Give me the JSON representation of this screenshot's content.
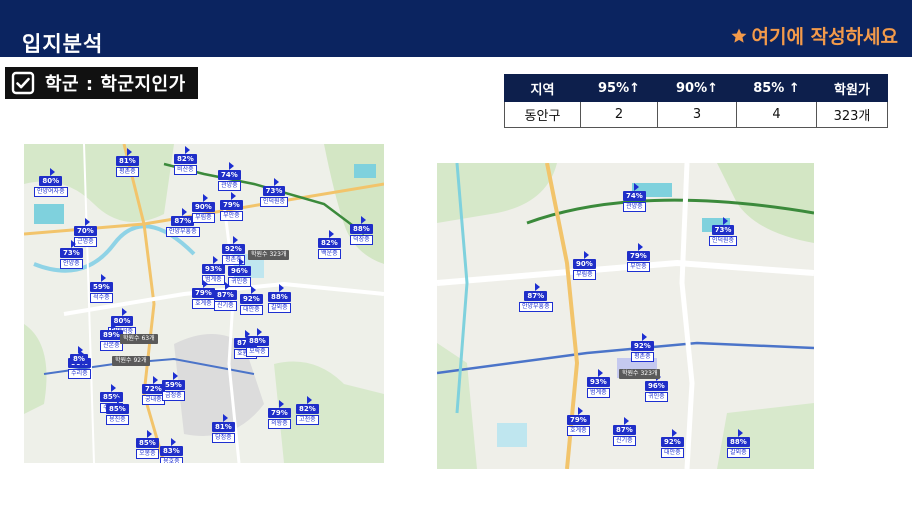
{
  "header": {
    "title": "입지분석",
    "note": "여기에 작성하세요",
    "note_color": "#f39a4a",
    "background": "#0b2460"
  },
  "section": {
    "label": "학군 : 학군지인가",
    "icon": "checkbox-icon"
  },
  "summary_table": {
    "headers": [
      "지역",
      "95%↑",
      "90%↑",
      "85% ↑",
      "학원가"
    ],
    "rows": [
      [
        "동안구",
        "2",
        "3",
        "4",
        "323개"
      ]
    ]
  },
  "map_left": {
    "markers": [
      {
        "pct": "81%",
        "school": "평촌중"
      },
      {
        "pct": "82%",
        "school": "비산중"
      },
      {
        "pct": "80%",
        "school": "안양여자중"
      },
      {
        "pct": "74%",
        "school": "관양중"
      },
      {
        "pct": "73%",
        "school": "인덕원중"
      },
      {
        "pct": "87%",
        "school": "안양부흥중"
      },
      {
        "pct": "90%",
        "school": "부림중"
      },
      {
        "pct": "79%",
        "school": "부안중"
      },
      {
        "pct": "70%",
        "school": "근명중"
      },
      {
        "pct": "73%",
        "school": "안양중"
      },
      {
        "pct": "88%",
        "school": "덕장중"
      },
      {
        "pct": "82%",
        "school": "백운중"
      },
      {
        "pct": "92%",
        "school": "평촌중"
      },
      {
        "pct": "93%",
        "school": "범계중"
      },
      {
        "pct": "96%",
        "school": "귀인중"
      },
      {
        "pct": "59%",
        "school": "석수중"
      },
      {
        "pct": "79%",
        "school": "호계중"
      },
      {
        "pct": "87%",
        "school": "신기중"
      },
      {
        "pct": "92%",
        "school": "대안중"
      },
      {
        "pct": "88%",
        "school": "갈뫼중"
      },
      {
        "pct": "80%",
        "school": "안양서중"
      },
      {
        "pct": "89%",
        "school": "산본중"
      },
      {
        "pct": "87%",
        "school": "호원중"
      },
      {
        "pct": "88%",
        "school": "모락중"
      },
      {
        "pct": "90%",
        "school": "수리중"
      },
      {
        "pct": "72%",
        "school": "궁내중"
      },
      {
        "pct": "59%",
        "school": "금정중"
      },
      {
        "pct": "85%",
        "school": "수리고"
      },
      {
        "pct": "85%",
        "school": "용진중"
      },
      {
        "pct": "81%",
        "school": "당정중"
      },
      {
        "pct": "79%",
        "school": "의왕중"
      },
      {
        "pct": "82%",
        "school": "고천중"
      },
      {
        "pct": "85%",
        "school": "오봉중"
      },
      {
        "pct": "83%",
        "school": "용호중"
      },
      {
        "pct": "8%",
        "school": ""
      }
    ],
    "academy_labels": [
      "학원수 323개",
      "학원수 63개",
      "학원수 92개"
    ]
  },
  "map_right": {
    "markers": [
      {
        "pct": "74%",
        "school": "관양중"
      },
      {
        "pct": "73%",
        "school": "인덕원중"
      },
      {
        "pct": "79%",
        "school": "부안중"
      },
      {
        "pct": "90%",
        "school": "부림중"
      },
      {
        "pct": "87%",
        "school": "안양부흥중"
      },
      {
        "pct": "92%",
        "school": "평촌중"
      },
      {
        "pct": "93%",
        "school": "범계중"
      },
      {
        "pct": "96%",
        "school": "귀인중"
      },
      {
        "pct": "79%",
        "school": "호계중"
      },
      {
        "pct": "87%",
        "school": "신기중"
      },
      {
        "pct": "92%",
        "school": "대안중"
      },
      {
        "pct": "88%",
        "school": "갈뫼중"
      }
    ],
    "academy_labels": [
      "학원수 323개"
    ]
  }
}
